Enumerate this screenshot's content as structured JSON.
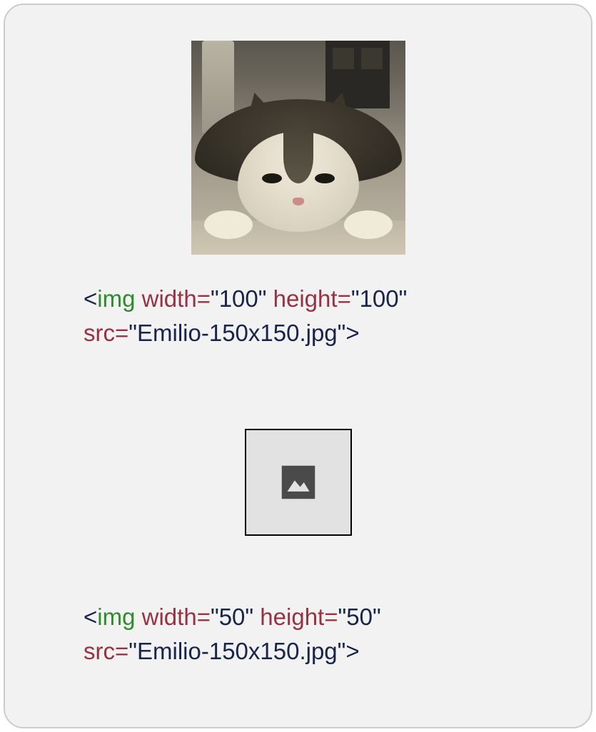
{
  "examples": [
    {
      "image_description": "cat-photo",
      "code_parts": {
        "lt": "<",
        "tag": "img",
        "sp1": " ",
        "attr_width": "width",
        "eq1": "=",
        "q1a": "\"",
        "val_width": "100",
        "q1b": "\"",
        "sp2": " ",
        "attr_height": "height",
        "eq2": "=",
        "q2a": "\"",
        "val_height": "100",
        "q2b": "\"",
        "br": "\n",
        "attr_src": "src",
        "eq3": "=",
        "q3a": "\"",
        "val_src": "Emilio-150x150.jpg",
        "q3b": "\"",
        "gt": ">"
      }
    },
    {
      "image_description": "broken-image-placeholder",
      "code_parts": {
        "lt": "<",
        "tag": "img",
        "sp1": " ",
        "attr_width": "width",
        "eq1": "=",
        "q1a": "\"",
        "val_width": "50",
        "q1b": "\"",
        "sp2": " ",
        "attr_height": "height",
        "eq2": "=",
        "q2a": "\"",
        "val_height": "50",
        "q2b": "\"",
        "br": "\n",
        "attr_src": "src",
        "eq3": "=",
        "q3a": "\"",
        "val_src": "Emilio-150x150.jpg",
        "q3b": "\"",
        "gt": ">"
      }
    }
  ]
}
